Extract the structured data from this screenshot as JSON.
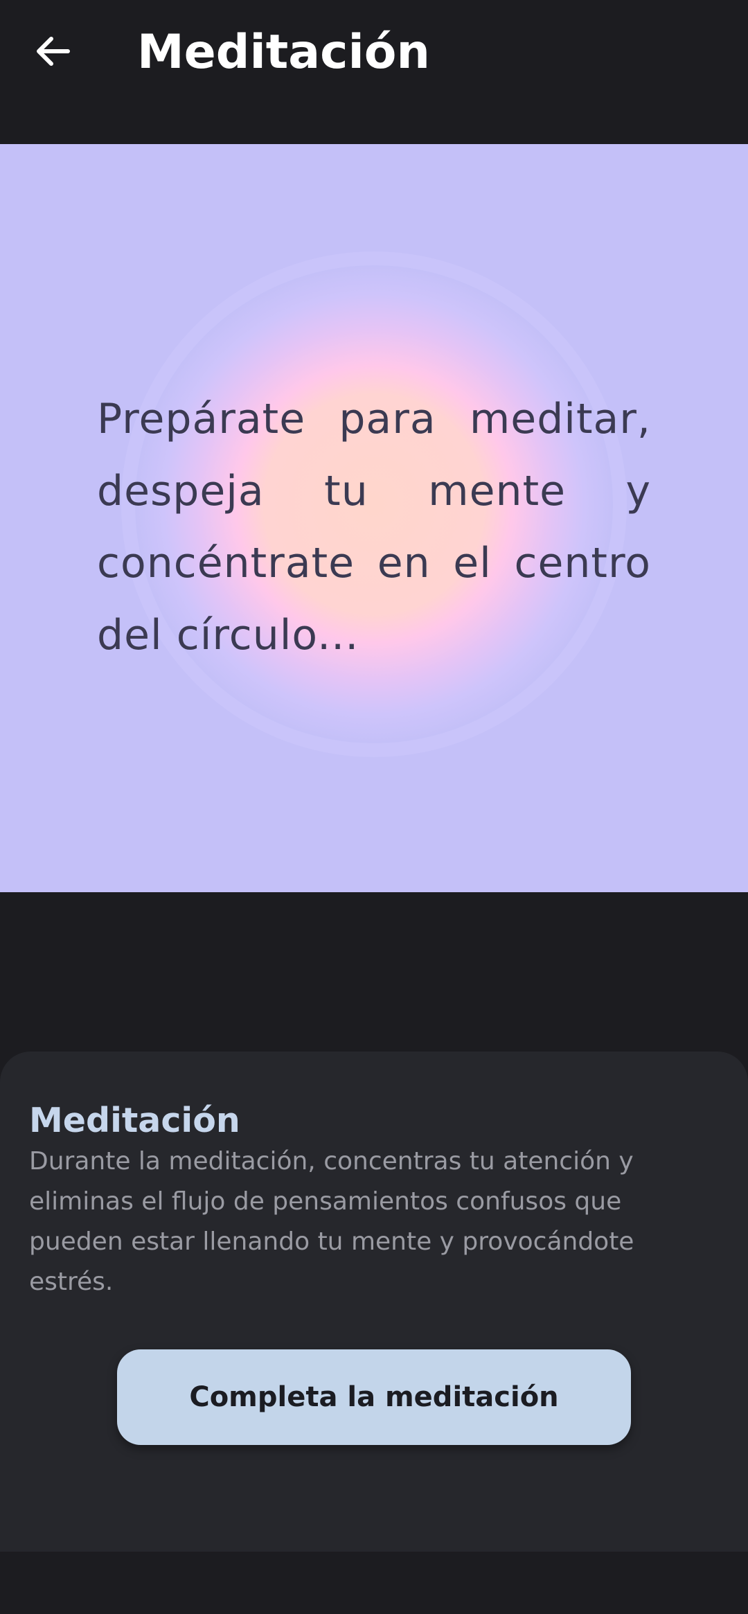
{
  "header": {
    "back_icon": "arrow-left-icon",
    "title": "Meditación"
  },
  "hero": {
    "text": "Prepárate para meditar, despeja tu mente y concéntrate en el centro del círculo...",
    "background_color": "#c4c0f8",
    "circle_colors": [
      "#ffd6cc",
      "#ffc8ea",
      "#dcc6fb"
    ]
  },
  "sheet": {
    "title": "Meditación",
    "description": "Durante la meditación, concentras tu atención y eliminas el flujo de pensamientos confusos que pueden estar llenando tu mente y provocándote estrés.",
    "button_label": "Completa la meditación"
  },
  "colors": {
    "background": "#1c1c20",
    "sheet": "#26272c",
    "accent": "#c3d5ea",
    "title_accent": "#c6d6ec"
  }
}
